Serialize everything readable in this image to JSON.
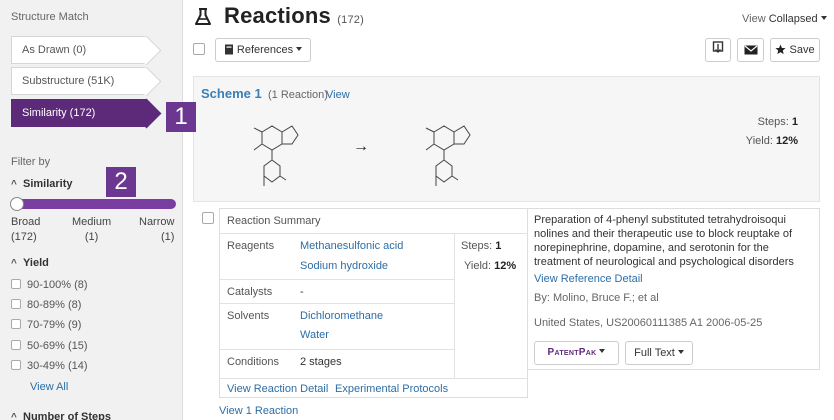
{
  "sidebar": {
    "structure_match_heading": "Structure Match",
    "match_options": [
      {
        "label": "As Drawn (0)"
      },
      {
        "label": "Substructure (51K)"
      },
      {
        "label": "Similarity (172)"
      }
    ],
    "filter_by": "Filter by",
    "similarity": {
      "title": "Similarity",
      "broad_label": "Broad",
      "broad_count": "(172)",
      "medium_label": "Medium",
      "medium_count": "(1)",
      "narrow_label": "Narrow",
      "narrow_count": "(1)"
    },
    "yield": {
      "title": "Yield",
      "options": [
        {
          "label": "90-100% (8)"
        },
        {
          "label": "80-89% (8)"
        },
        {
          "label": "70-79% (9)"
        },
        {
          "label": "50-69% (15)"
        },
        {
          "label": "30-49% (14)"
        }
      ],
      "view_all": "View All"
    },
    "steps_facet_title": "Number of Steps"
  },
  "markers": {
    "one": "1",
    "two": "2"
  },
  "header": {
    "title": "Reactions",
    "count": "(172)",
    "view_label": "View",
    "view_value": "Collapsed"
  },
  "toolbar": {
    "references_label": "References",
    "save_label": "Save"
  },
  "scheme": {
    "title": "Scheme 1",
    "subtitle": "(1 Reaction)",
    "view_link": "View",
    "arrow": "→",
    "steps_label": "Steps:",
    "steps_value": "1",
    "yield_label": "Yield:",
    "yield_value": "12%"
  },
  "reaction": {
    "summary_label": "Reaction Summary",
    "reagents_label": "Reagents",
    "reagents": [
      "Methanesulfonic acid",
      "Sodium hydroxide"
    ],
    "steps_label": "Steps:",
    "steps_value": "1",
    "yield_label": "Yield:",
    "yield_value": "12%",
    "catalysts_label": "Catalysts",
    "catalysts_value": "-",
    "solvents_label": "Solvents",
    "solvents": [
      "Dichloromethane",
      "Water"
    ],
    "conditions_label": "Conditions",
    "conditions_value": "2 stages",
    "view_detail_link": "View Reaction Detail",
    "protocols_link": "Experimental Protocols"
  },
  "reference": {
    "description": "Preparation of 4-phenyl substituted tetrahydroisoquinolines and their therapeutic use to block reuptake of norepinephrine, dopamine, and serotonin for the treatment of neurological and psychological disorders",
    "desc_line1": "Preparation of 4-phenyl substituted tetrahydroisoqui",
    "desc_line2": "nolines and their therapeutic use to block reuptake of",
    "desc_line3": "norepinephrine, dopamine, and serotonin for the",
    "desc_line4": "treatment of neurological and psychological disorders",
    "detail_link": "View Reference Detail",
    "byline": "By: Molino, Bruce F.; et al",
    "patent": "United States, US20060111385 A1 2006-05-25",
    "patentpak_label": "PatentPak",
    "fulltext_label": "Full Text"
  },
  "footer": {
    "view_one": "View 1 Reaction"
  },
  "colors": {
    "accent_purple": "#5d2a7a",
    "marker_purple": "#6b3791",
    "link_blue": "#2c6ea6"
  },
  "icons": [
    "flask-icon",
    "book-icon",
    "download-icon",
    "envelope-icon",
    "star-icon",
    "chevron-up-icon",
    "caret-down-icon"
  ]
}
